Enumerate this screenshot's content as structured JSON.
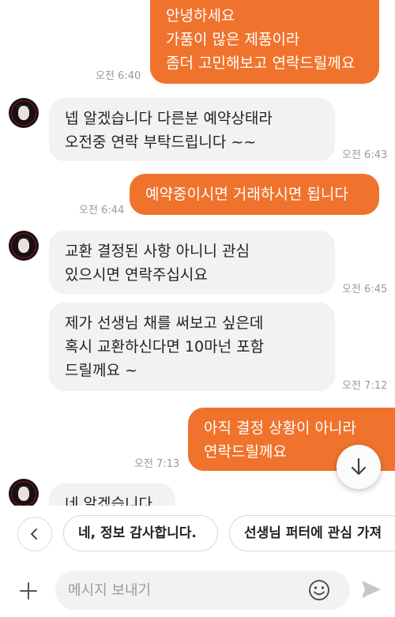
{
  "chat": {
    "messages": [
      {
        "id": "m1",
        "dir": "out",
        "text": "안녕하세요\n가품이 많은 제품이라\n좀더 고민해보고 연락드릴께요",
        "time": "오전 6:40"
      },
      {
        "id": "m2",
        "dir": "in",
        "text": "넵 알겠습니다 다른분 예약상태라\n오전중 연락 부탁드립니다 ~~",
        "time": "오전 6:43"
      },
      {
        "id": "m3",
        "dir": "out",
        "text": "예약중이시면 거래하시면 됩니다",
        "time": "오전 6:44"
      },
      {
        "id": "m4",
        "dir": "in",
        "text": "교환 결정된 사항 아니니 관심\n있으시면 연락주십시요",
        "time": "오전 6:45"
      },
      {
        "id": "m5",
        "dir": "in",
        "text": "제가 선생님 채를 써보고 싶은데\n혹시 교환하신다면 10마넌 포함\n드릴께요 ~",
        "time": "오전 7:12"
      },
      {
        "id": "m6",
        "dir": "out",
        "text": "아직 결정  상황이 아니라\n연락드릴께요",
        "time": "오전 7:13"
      },
      {
        "id": "m7",
        "dir": "in",
        "text": "네 알겠습니다",
        "time": ""
      }
    ]
  },
  "quick_replies": {
    "items": [
      "네, 정보 감사합니다.",
      "선생님 퍼터에 관심 가져"
    ]
  },
  "composer": {
    "placeholder": "메시지 보내기"
  },
  "icons": {
    "scroll_down": "arrow-down-icon",
    "back": "chevron-left-icon",
    "plus": "plus-icon",
    "emoji": "smiley-icon",
    "send": "send-icon"
  },
  "colors": {
    "outgoing_bubble": "#f0732d",
    "incoming_bubble": "#f1f2f4"
  }
}
